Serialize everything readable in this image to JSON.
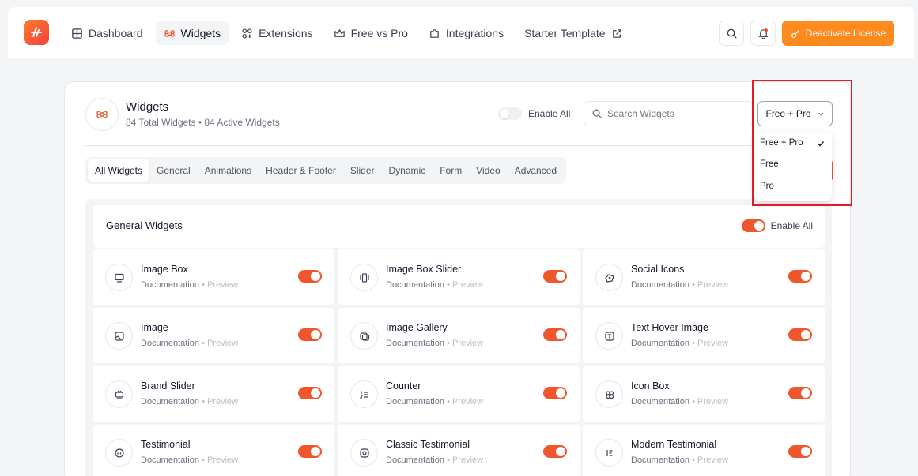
{
  "nav": {
    "items": [
      {
        "label": "Dashboard",
        "icon": "grid-icon",
        "active": false
      },
      {
        "label": "Widgets",
        "icon": "command-icon",
        "active": true
      },
      {
        "label": "Extensions",
        "icon": "extensions-icon",
        "active": false
      },
      {
        "label": "Free vs Pro",
        "icon": "crown-icon",
        "active": false
      },
      {
        "label": "Integrations",
        "icon": "puzzle-icon",
        "active": false
      },
      {
        "label": "Starter Template",
        "icon": "external-link-icon",
        "active": false
      }
    ],
    "deactivate_label": "Deactivate License"
  },
  "header": {
    "title": "Widgets",
    "subtitle": "84 Total Widgets • 84 Active Widgets",
    "enable_all_label": "Enable All",
    "search_placeholder": "Search Widgets",
    "filter_selected": "Free + Pro"
  },
  "tabs": [
    "All Widgets",
    "General",
    "Animations",
    "Header & Footer",
    "Slider",
    "Dynamic",
    "Form",
    "Video",
    "Advanced"
  ],
  "panel": {
    "title": "General Widgets",
    "enable_all_label": "Enable All"
  },
  "widgets": [
    {
      "name": "Image Box",
      "icon": "image-box-icon"
    },
    {
      "name": "Image Box Slider",
      "icon": "slider-icon"
    },
    {
      "name": "Social Icons",
      "icon": "social-icon"
    },
    {
      "name": "Image",
      "icon": "image-icon"
    },
    {
      "name": "Image Gallery",
      "icon": "gallery-icon"
    },
    {
      "name": "Text Hover Image",
      "icon": "text-icon"
    },
    {
      "name": "Brand Slider",
      "icon": "brand-icon"
    },
    {
      "name": "Counter",
      "icon": "counter-icon"
    },
    {
      "name": "Icon Box",
      "icon": "icon-box-icon"
    },
    {
      "name": "Testimonial",
      "icon": "quote-icon"
    },
    {
      "name": "Classic Testimonial",
      "icon": "classic-testimonial-icon"
    },
    {
      "name": "Modern Testimonial",
      "icon": "modern-testimonial-icon"
    }
  ],
  "links": {
    "documentation": "Documentation",
    "separator": "•",
    "preview": "Preview"
  },
  "dropdown": {
    "options": [
      "Free + Pro",
      "Free",
      "Pro"
    ],
    "selected": "Free + Pro"
  },
  "colors": {
    "accent": "#f0562c",
    "deactivate": "#ff8a1e",
    "highlight": "#e31b23"
  }
}
